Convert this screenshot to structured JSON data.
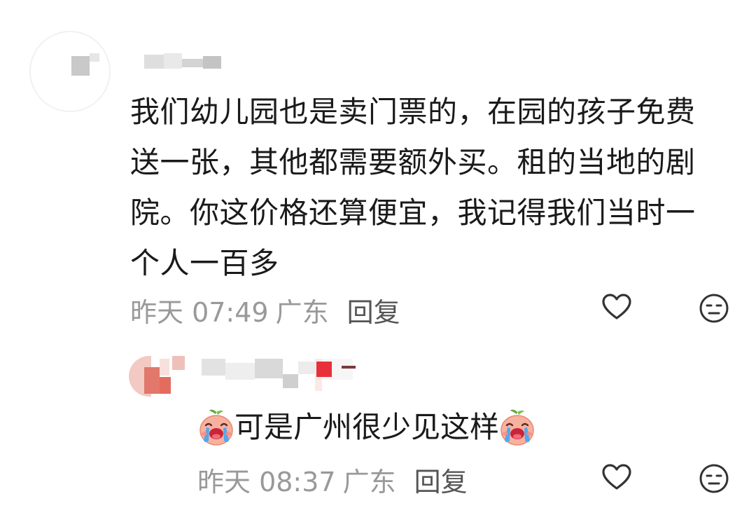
{
  "comment": {
    "text_lines": [
      "我们幼儿园也是卖门票的，在园的孩子免费",
      "送一张，其他都需要额外买。租的当地的剧",
      "院。你这价格还算便宜，我记得我们当时一",
      "个人一百多"
    ],
    "time": "昨天 07:49",
    "location": "广东",
    "reply_label": "回复",
    "like_icon": "heart-outline-icon",
    "dislike_icon": "neutral-face-icon"
  },
  "reply": {
    "emoji_icon": "crying-peach-emoji",
    "text": "可是广州很少见这样",
    "time": "昨天 08:37",
    "location": "广东",
    "reply_label": "回复",
    "like_icon": "heart-outline-icon",
    "dislike_icon": "neutral-face-icon"
  },
  "colors": {
    "text": "#1a1a1a",
    "meta": "#999999",
    "reply_label": "#555555",
    "icon": "#333333"
  }
}
